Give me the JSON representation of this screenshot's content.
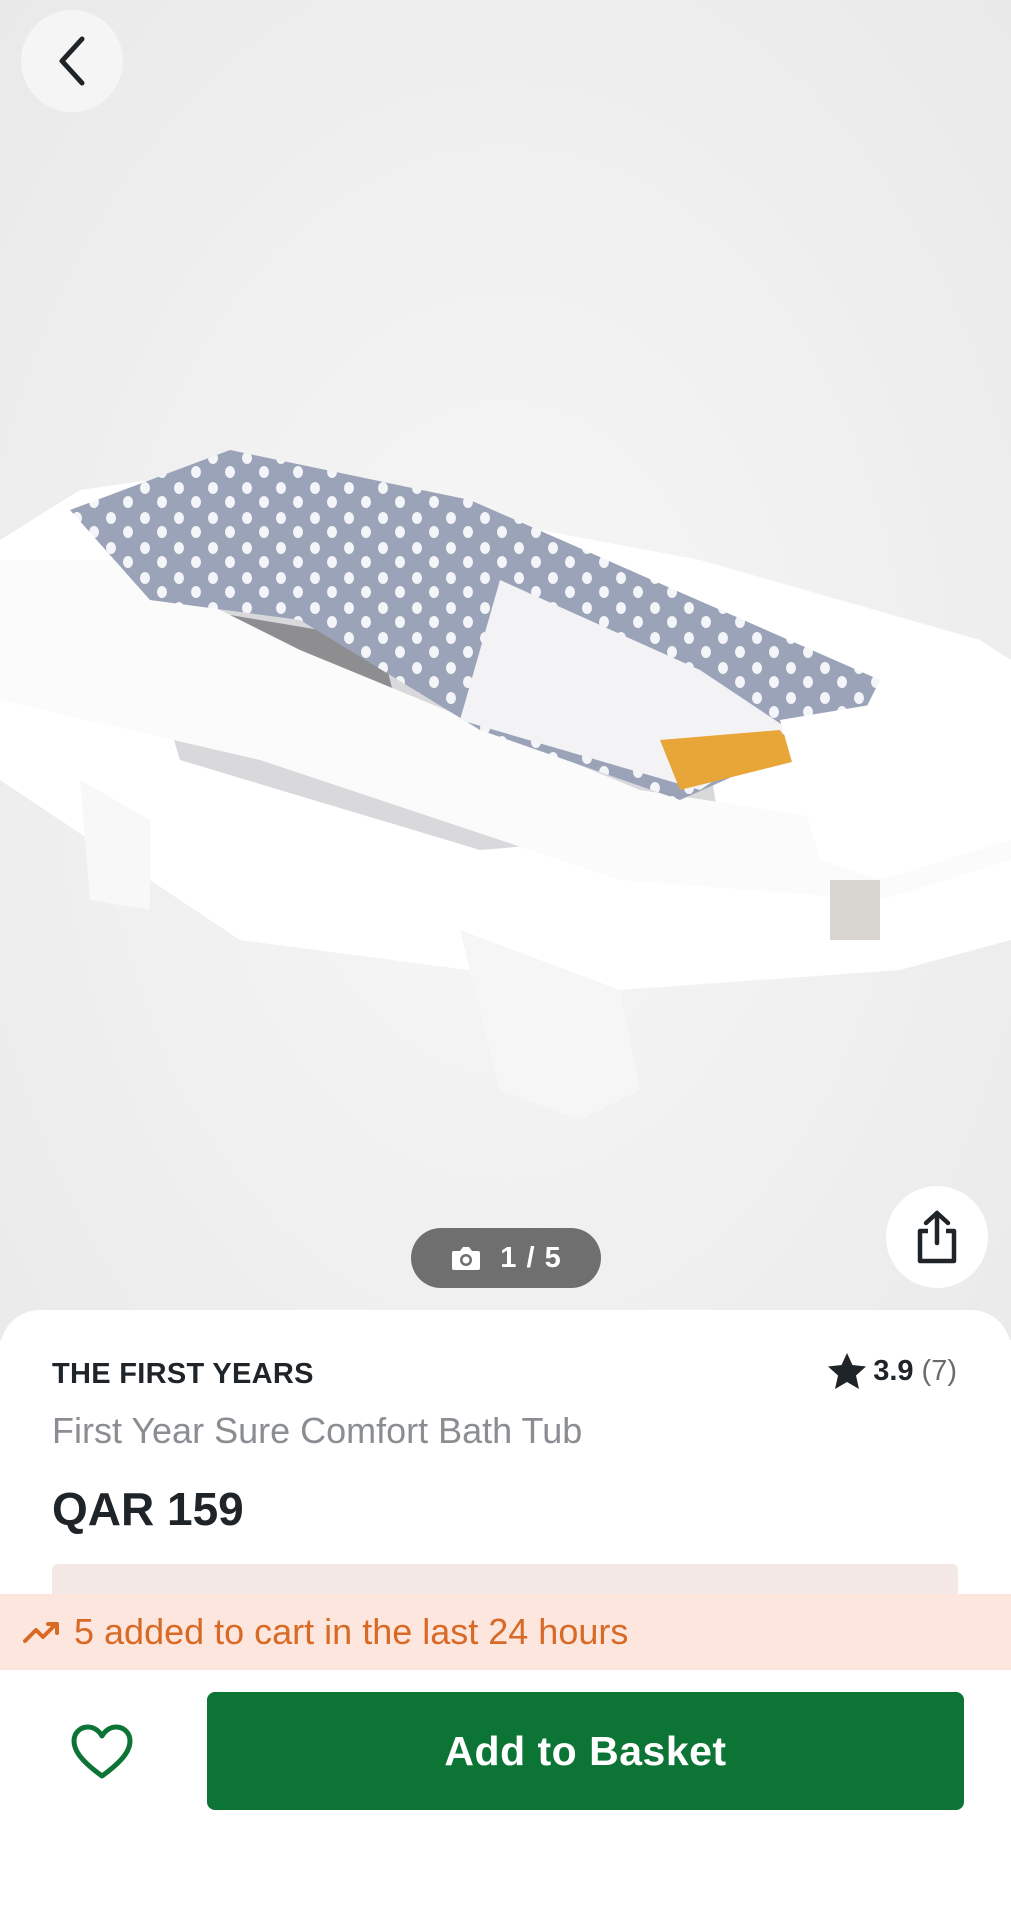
{
  "nav": {
    "back_icon": "chevron-left-icon",
    "share_icon": "share-icon"
  },
  "gallery": {
    "counter_icon": "camera-icon",
    "counter": "1 / 5",
    "current_image": 1,
    "total_images": 5
  },
  "product": {
    "brand": "THE FIRST YEARS",
    "name": "First Year Sure Comfort Bath Tub",
    "price": "QAR 159",
    "rating": {
      "value": "3.9",
      "count": "(7)",
      "icon": "star-icon"
    }
  },
  "cart_banner": {
    "icon": "trending-up-icon",
    "text": "5 added to cart in the last 24 hours"
  },
  "actions": {
    "wishlist_icon": "heart-icon",
    "add_to_basket": "Add to Basket"
  },
  "colors": {
    "primary_green": "#0c7434",
    "banner_bg": "#fde6dd",
    "banner_text": "#d86a26",
    "text_dark": "#1f2428",
    "text_muted": "#8a8d91"
  }
}
